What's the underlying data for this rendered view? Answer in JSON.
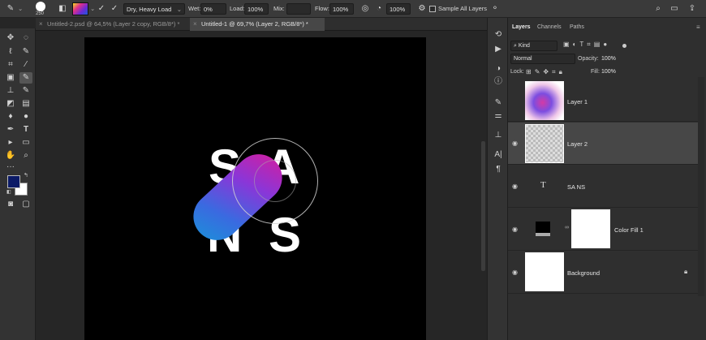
{
  "options_bar": {
    "brush_size": "250",
    "mix_preset": "Dry, Heavy Load",
    "wet_label": "Wet:",
    "wet_value": "0%",
    "load_label": "Load:",
    "load_value": "100%",
    "mix_label": "Mix:",
    "mix_value": "",
    "flow_label": "Flow:",
    "flow_value": "100%",
    "smoothing_value": "100%",
    "sample_all_layers": "Sample All Layers"
  },
  "tabs": [
    {
      "label": "Untitled-2.psd @ 64,5% (Layer 2 copy, RGB/8*) *",
      "active": false
    },
    {
      "label": "Untitled-1 @ 69,7% (Layer 2, RGB/8*) *",
      "active": true
    }
  ],
  "canvas": {
    "letters_top": [
      "S",
      "A"
    ],
    "letters_bottom": [
      "N",
      "S"
    ]
  },
  "panel": {
    "tabs": [
      "Layers",
      "Channels",
      "Paths"
    ],
    "filter_kind": "Kind",
    "blend_mode": "Normal",
    "opacity_label": "Opacity:",
    "opacity_value": "100%",
    "lock_label": "Lock:",
    "fill_label": "Fill:",
    "fill_value": "100%"
  },
  "layers": [
    {
      "name": "Layer 1",
      "type": "gradient",
      "selected": false
    },
    {
      "name": "Layer 2",
      "type": "transparent",
      "selected": true
    },
    {
      "name": "SA NS",
      "type": "text",
      "selected": false
    },
    {
      "name": "Color Fill 1",
      "type": "fill",
      "selected": false
    },
    {
      "name": "Background",
      "type": "background",
      "selected": false
    }
  ],
  "colors": {
    "foreground": "#0b1a66",
    "background": "#ffffff",
    "pill_start": "#d21ea0",
    "pill_end": "#1c8fd9"
  }
}
